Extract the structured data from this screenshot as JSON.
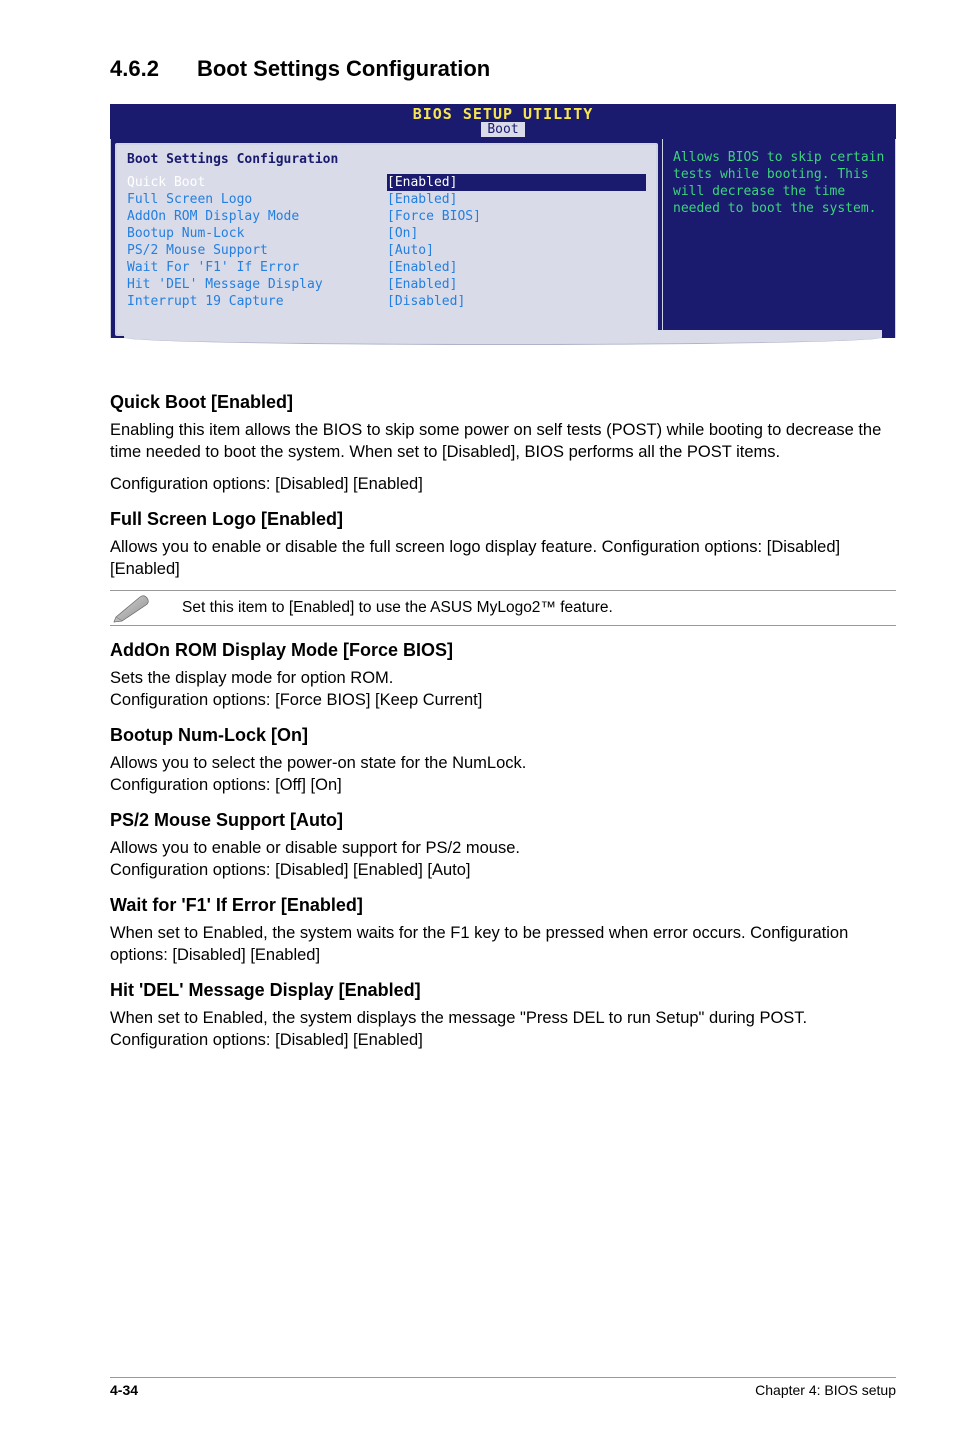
{
  "section": {
    "number": "4.6.2",
    "title": "Boot Settings Configuration"
  },
  "bios": {
    "top": "BIOS SETUP UTILITY",
    "tab": "Boot",
    "heading": "Boot Settings Configuration",
    "rows": [
      {
        "label": "Quick Boot",
        "value": "[Enabled]",
        "selected": true
      },
      {
        "label": "Full Screen Logo",
        "value": "[Enabled]",
        "selected": false
      },
      {
        "label": "AddOn ROM Display Mode",
        "value": "[Force BIOS]",
        "selected": false
      },
      {
        "label": "Bootup Num-Lock",
        "value": "[On]",
        "selected": false
      },
      {
        "label": "PS/2 Mouse Support",
        "value": "[Auto]",
        "selected": false
      },
      {
        "label": "Wait For 'F1' If Error",
        "value": "[Enabled]",
        "selected": false
      },
      {
        "label": "Hit 'DEL' Message Display",
        "value": "[Enabled]",
        "selected": false
      },
      {
        "label": "Interrupt 19 Capture",
        "value": "[Disabled]",
        "selected": false
      }
    ],
    "help": "Allows BIOS to skip certain tests while booting. This will decrease the time needed to boot the system."
  },
  "items": {
    "quick_boot": {
      "h": "Quick Boot [Enabled]",
      "p1": "Enabling this item allows the BIOS to skip some power on self tests (POST) while booting to decrease the time needed to boot the system. When set to [Disabled], BIOS performs all the POST items.",
      "p2": "Configuration options: [Disabled] [Enabled]"
    },
    "full_screen": {
      "h": "Full Screen Logo [Enabled]",
      "p1": "Allows you to enable or disable the full screen logo display feature. Configuration options: [Disabled] [Enabled]"
    },
    "note": "Set this item to [Enabled] to use the ASUS MyLogo2™ feature.",
    "addon": {
      "h": "AddOn ROM Display Mode [Force BIOS]",
      "p1": "Sets the display mode for option ROM.",
      "p2": "Configuration options: [Force BIOS] [Keep Current]"
    },
    "numlock": {
      "h": "Bootup Num-Lock [On]",
      "p1": "Allows you to select the power-on state for the NumLock.",
      "p2": "Configuration options: [Off] [On]"
    },
    "ps2": {
      "h": "PS/2 Mouse Support [Auto]",
      "p1": "Allows you to enable or disable support for PS/2 mouse.",
      "p2": "Configuration options: [Disabled] [Enabled] [Auto]"
    },
    "f1": {
      "h": "Wait for 'F1' If Error [Enabled]",
      "p1": "When set to Enabled, the system waits for the F1 key to be pressed when error occurs. Configuration options: [Disabled] [Enabled]"
    },
    "del": {
      "h": "Hit 'DEL' Message Display [Enabled]",
      "p1": "When set to Enabled, the system displays the message \"Press DEL to run Setup\" during POST. Configuration options: [Disabled] [Enabled]"
    }
  },
  "footer": {
    "page": "4-34",
    "chapter": "Chapter 4: BIOS setup"
  }
}
